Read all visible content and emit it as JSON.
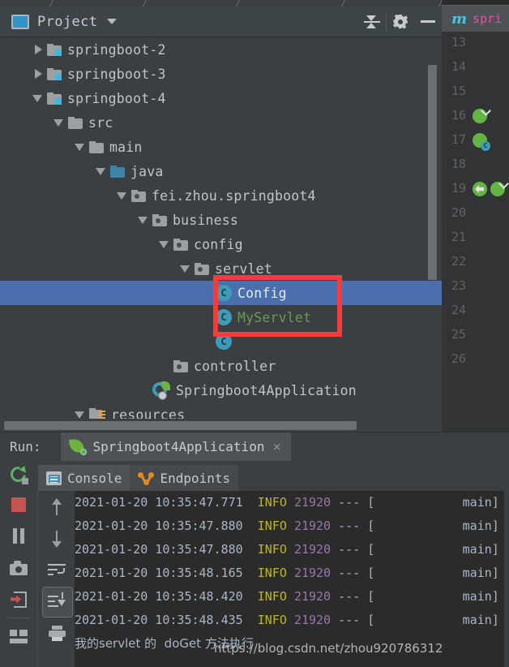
{
  "project_panel": {
    "title": "Project",
    "icon": "project-window-icon",
    "dropdown_caret": "chevron-down-icon",
    "toolbar": [
      {
        "name": "collapse-all-button",
        "icon": "collapse-all-icon"
      },
      {
        "name": "settings-button",
        "icon": "gear-icon"
      },
      {
        "name": "hide-button",
        "icon": "minimize-icon"
      }
    ],
    "tree": [
      {
        "label": "springboot-2",
        "indent": 1,
        "arrow": "right",
        "icon": "module-folder-icon",
        "style": "normal",
        "selected": false
      },
      {
        "label": "springboot-3",
        "indent": 1,
        "arrow": "right",
        "icon": "module-folder-icon",
        "style": "normal",
        "selected": false
      },
      {
        "label": "springboot-4",
        "indent": 1,
        "arrow": "down",
        "icon": "module-folder-icon",
        "style": "normal",
        "selected": false
      },
      {
        "label": "src",
        "indent": 2,
        "arrow": "down",
        "icon": "folder-icon",
        "style": "normal",
        "selected": false
      },
      {
        "label": "main",
        "indent": 3,
        "arrow": "down",
        "icon": "folder-icon",
        "style": "normal",
        "selected": false
      },
      {
        "label": "java",
        "indent": 4,
        "arrow": "down",
        "icon": "source-folder-icon",
        "style": "normal",
        "selected": false
      },
      {
        "label": "fei.zhou.springboot4",
        "indent": 5,
        "arrow": "down",
        "icon": "package-icon",
        "style": "normal",
        "selected": false
      },
      {
        "label": "business",
        "indent": 6,
        "arrow": "down",
        "icon": "package-icon",
        "style": "normal",
        "selected": false
      },
      {
        "label": "config",
        "indent": 7,
        "arrow": "down",
        "icon": "package-icon",
        "style": "normal",
        "selected": false
      },
      {
        "label": "servlet",
        "indent": 8,
        "arrow": "down",
        "icon": "package-icon",
        "style": "normal",
        "selected": false
      },
      {
        "label": "Config",
        "indent": 9,
        "arrow": "none",
        "icon": "java-class-icon",
        "style": "white",
        "selected": true
      },
      {
        "label": "MyServlet",
        "indent": 9,
        "arrow": "none",
        "icon": "java-class-icon",
        "style": "green",
        "selected": false
      },
      {
        "label": "",
        "indent": 9,
        "arrow": "none",
        "icon": "java-class-icon",
        "style": "green",
        "selected": false
      },
      {
        "label": "controller",
        "indent": 7,
        "arrow": "none",
        "icon": "package-icon",
        "style": "normal",
        "selected": false
      },
      {
        "label": "Springboot4Application",
        "indent": 6,
        "arrow": "none",
        "icon": "spring-app-icon",
        "style": "normal",
        "selected": false
      },
      {
        "label": "resources",
        "indent": 3,
        "arrow": "down",
        "icon": "resources-folder-icon",
        "style": "normal",
        "selected": false
      }
    ],
    "highlight_box_color": "#f93a3a"
  },
  "editor": {
    "tab": {
      "prefix": "m",
      "name": "spri",
      "icon": "maven-file-icon"
    },
    "lines": [
      {
        "num": "13",
        "icons": []
      },
      {
        "num": "14",
        "icons": []
      },
      {
        "num": "15",
        "icons": []
      },
      {
        "num": "16",
        "icons": [
          "run-gutter-icon"
        ]
      },
      {
        "num": "17",
        "icons": [
          "bean-gutter-icon"
        ]
      },
      {
        "num": "18",
        "icons": []
      },
      {
        "num": "19",
        "icons": [
          "override-gutter-icon",
          "run-gutter-icon"
        ]
      },
      {
        "num": "20",
        "icons": []
      },
      {
        "num": "21",
        "icons": []
      },
      {
        "num": "22",
        "icons": []
      },
      {
        "num": "23",
        "icons": []
      },
      {
        "num": "24",
        "icons": []
      },
      {
        "num": "25",
        "icons": []
      },
      {
        "num": "26",
        "icons": []
      }
    ]
  },
  "run_window": {
    "label": "Run:",
    "configuration_name": "Springboot4Application",
    "configuration_icon": "spring-boot-run-icon",
    "close_label": "×",
    "tabs": [
      {
        "label": "Console",
        "icon": "console-icon",
        "active": true
      },
      {
        "label": "Endpoints",
        "icon": "endpoints-icon",
        "active": false
      }
    ],
    "left_toolbar": [
      {
        "name": "rerun-button",
        "icon": "rerun-icon"
      },
      {
        "name": "stop-button",
        "icon": "stop-icon"
      },
      {
        "name": "pause-button",
        "icon": "pause-icon"
      },
      {
        "name": "screenshot-button",
        "icon": "camera-icon"
      },
      {
        "name": "exit-button",
        "icon": "exit-icon"
      },
      {
        "name": "layout-button",
        "icon": "layout-icon"
      }
    ],
    "right_toolbar": [
      {
        "name": "prev-occurrence-button",
        "icon": "arrow-up-icon"
      },
      {
        "name": "next-occurrence-button",
        "icon": "arrow-down-icon"
      },
      {
        "name": "soft-wrap-button",
        "icon": "soft-wrap-icon"
      },
      {
        "name": "scroll-to-end-button",
        "icon": "scroll-to-end-icon",
        "active": true
      },
      {
        "name": "print-button",
        "icon": "print-icon"
      }
    ]
  },
  "console_output": {
    "lines": [
      {
        "timestamp": "2021-01-20 10:35:47.771",
        "level": "INFO",
        "pid": "21920",
        "sep": "---",
        "bracket": "[",
        "thread": "main]"
      },
      {
        "timestamp": "2021-01-20 10:35:47.880",
        "level": "INFO",
        "pid": "21920",
        "sep": "---",
        "bracket": "[",
        "thread": "main]"
      },
      {
        "timestamp": "2021-01-20 10:35:47.880",
        "level": "INFO",
        "pid": "21920",
        "sep": "---",
        "bracket": "[",
        "thread": "main]"
      },
      {
        "timestamp": "2021-01-20 10:35:48.165",
        "level": "INFO",
        "pid": "21920",
        "sep": "---",
        "bracket": "[",
        "thread": "main]"
      },
      {
        "timestamp": "2021-01-20 10:35:48.420",
        "level": "INFO",
        "pid": "21920",
        "sep": "---",
        "bracket": "[",
        "thread": "main]"
      },
      {
        "timestamp": "2021-01-20 10:35:48.435",
        "level": "INFO",
        "pid": "21920",
        "sep": "---",
        "bracket": "[",
        "thread": "main]"
      }
    ],
    "final_line": "我的servlet 的  doGet 方法执行"
  },
  "watermark": "https://blog.csdn.net/zhou920786312"
}
